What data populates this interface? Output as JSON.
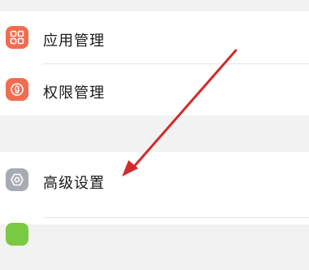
{
  "settings_list": {
    "items": [
      {
        "label": "应用管理",
        "icon": "app-grid-icon",
        "icon_color": "#f26c50"
      },
      {
        "label": "权限管理",
        "icon": "permission-icon",
        "icon_color": "#f26c50"
      },
      {
        "label": "高级设置",
        "icon": "gear-icon",
        "icon_color": "#a7abb3"
      },
      {
        "label": "",
        "icon": "green-icon",
        "icon_color": "#7ac943"
      }
    ]
  },
  "annotation": {
    "arrow_color": "#d42a2a"
  }
}
